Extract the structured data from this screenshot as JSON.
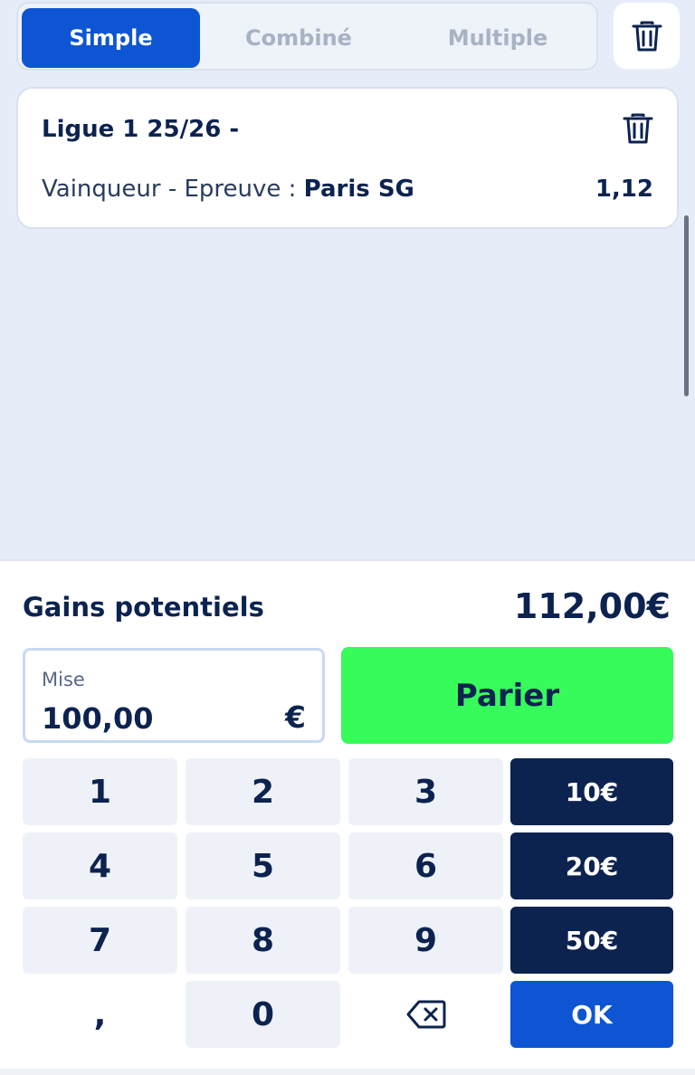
{
  "tabs": [
    {
      "label": "Simple",
      "active": true
    },
    {
      "label": "Combiné",
      "active": false
    },
    {
      "label": "Multiple",
      "active": false
    }
  ],
  "bet": {
    "title": "Ligue 1 25/26 -",
    "market": "Vainqueur - Epreuve : ",
    "selection": "Paris SG",
    "odds": "1,12"
  },
  "summary": {
    "gains_label": "Gains potentiels",
    "gains_value": "112,00€"
  },
  "stake": {
    "label": "Mise",
    "value": "100,00",
    "currency": "€"
  },
  "actions": {
    "bet_label": "Parier"
  },
  "keypad": {
    "digits": [
      "1",
      "2",
      "3",
      "4",
      "5",
      "6",
      "7",
      "8",
      "9",
      ",",
      "0"
    ],
    "quick": [
      "10€",
      "20€",
      "50€"
    ],
    "ok_label": "OK"
  },
  "icons": {
    "trash": "trash-icon",
    "backspace": "backspace-icon"
  },
  "colors": {
    "primary": "#0d55d3",
    "navy": "#0c2350",
    "bet_button": "#37fa5b",
    "background": "#e7edf8"
  }
}
